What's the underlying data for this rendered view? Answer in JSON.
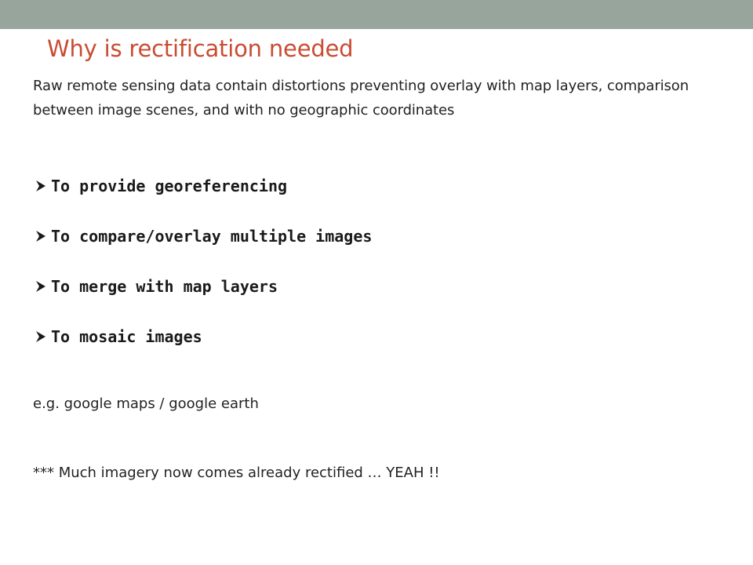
{
  "slide": {
    "title": "Why is rectification needed",
    "intro": "Raw remote sensing data contain distortions preventing overlay with map layers, comparison between image scenes, and with no geographic coordinates",
    "bullets": [
      {
        "label": "To provide georeferencing"
      },
      {
        "label": "To compare/overlay multiple images"
      },
      {
        "label": "To merge with map layers"
      },
      {
        "label": "To mosaic images"
      }
    ],
    "example": "e.g.  google maps / google earth",
    "note": "*** Much imagery now comes already rectified … YEAH !!"
  },
  "colors": {
    "top_bar": "#98a59c",
    "title": "#c94c33",
    "text": "#222222"
  },
  "icons": {
    "bullet": "arrow-bullet-icon"
  }
}
